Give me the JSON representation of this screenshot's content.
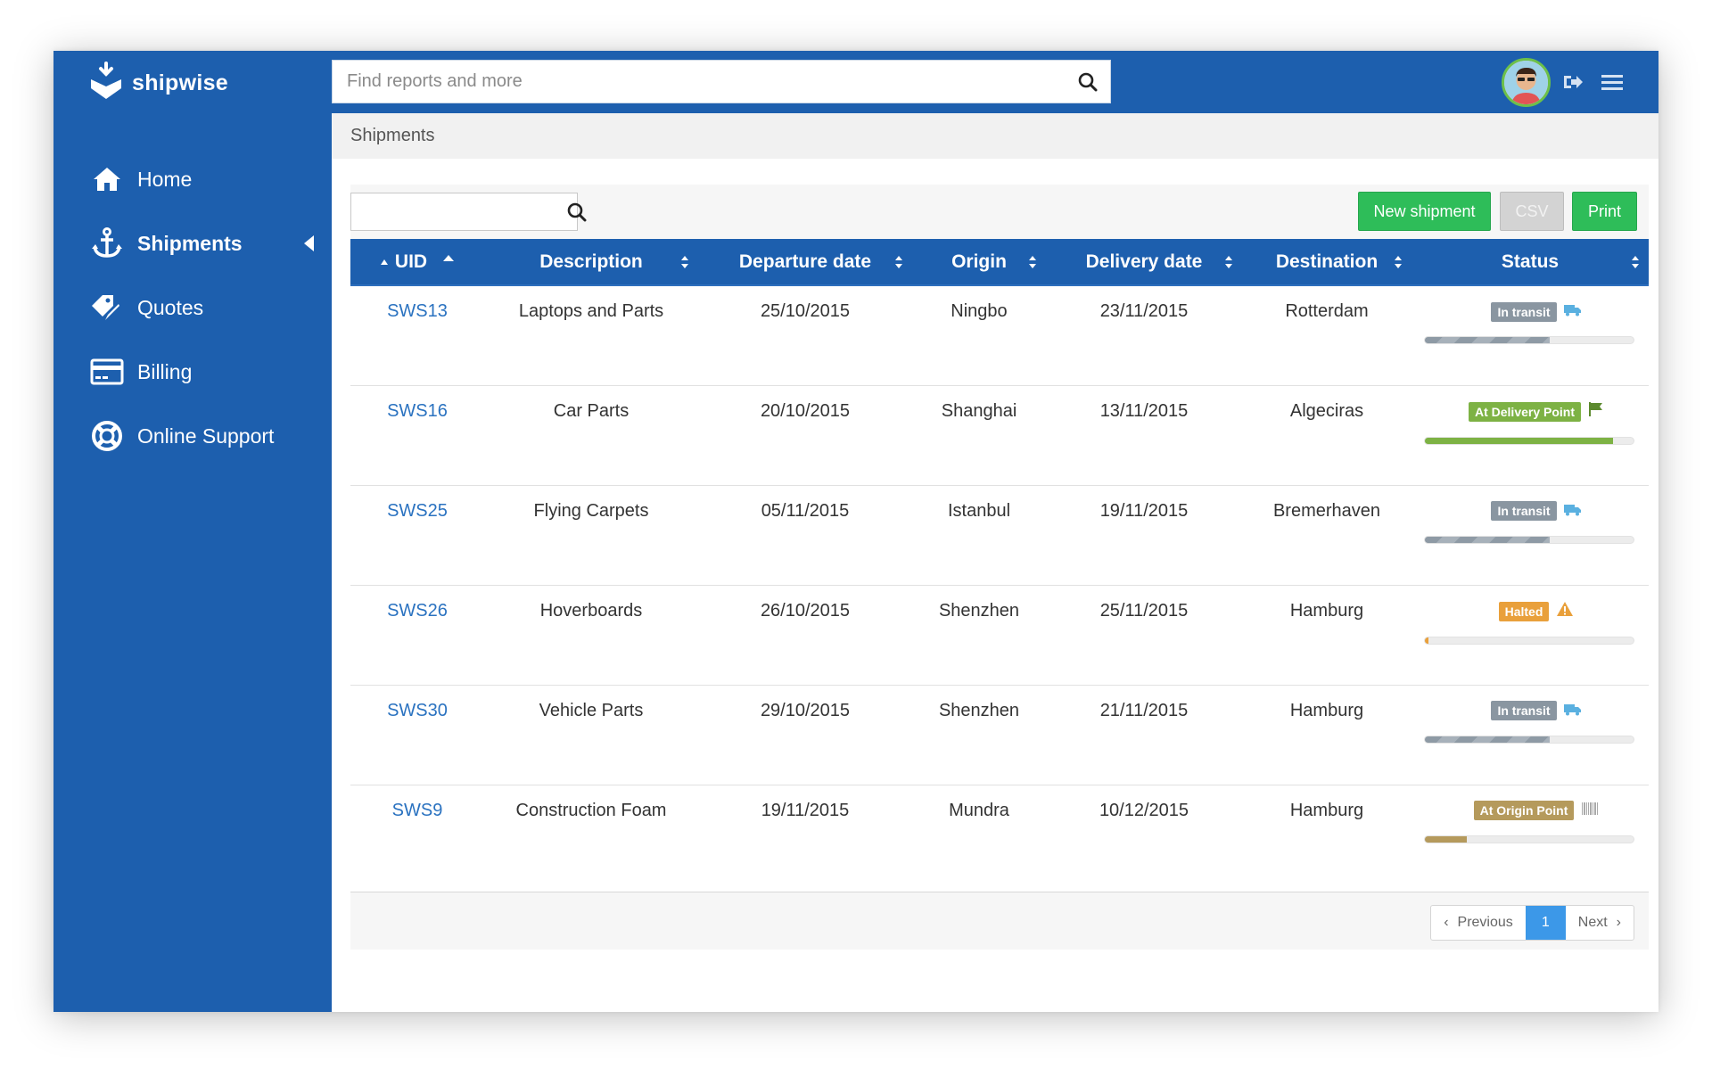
{
  "app": {
    "name": "shipwise"
  },
  "search": {
    "placeholder": "Find reports and more"
  },
  "sidebar": {
    "items": [
      {
        "label": "Home",
        "icon": "home-icon",
        "active": false
      },
      {
        "label": "Shipments",
        "icon": "anchor-icon",
        "active": true
      },
      {
        "label": "Quotes",
        "icon": "tags-icon",
        "active": false
      },
      {
        "label": "Billing",
        "icon": "credit-card-icon",
        "active": false
      },
      {
        "label": "Online Support",
        "icon": "lifebuoy-icon",
        "active": false
      }
    ]
  },
  "breadcrumb": "Shipments",
  "toolbar": {
    "new_label": "New shipment",
    "csv_label": "CSV",
    "print_label": "Print"
  },
  "table": {
    "columns": [
      "UID",
      "Description",
      "Departure date",
      "Origin",
      "Delivery date",
      "Destination",
      "Status"
    ],
    "rows": [
      {
        "uid": "SWS13",
        "description": "Laptops and Parts",
        "departure": "25/10/2015",
        "origin": "Ningbo",
        "delivery": "23/11/2015",
        "destination": "Rotterdam",
        "status": "In transit",
        "status_color": "#8a96a1",
        "icon": "truck-icon",
        "progress": 0.6,
        "bar": "stripe"
      },
      {
        "uid": "SWS16",
        "description": "Car Parts",
        "departure": "20/10/2015",
        "origin": "Shanghai",
        "delivery": "13/11/2015",
        "destination": "Algeciras",
        "status": "At Delivery Point",
        "status_color": "#7db244",
        "icon": "flag-icon",
        "progress": 0.9,
        "bar": "green"
      },
      {
        "uid": "SWS25",
        "description": "Flying Carpets",
        "departure": "05/11/2015",
        "origin": "Istanbul",
        "delivery": "19/11/2015",
        "destination": "Bremerhaven",
        "status": "In transit",
        "status_color": "#8a96a1",
        "icon": "truck-icon",
        "progress": 0.6,
        "bar": "stripe"
      },
      {
        "uid": "SWS26",
        "description": "Hoverboards",
        "departure": "26/10/2015",
        "origin": "Shenzhen",
        "delivery": "25/11/2015",
        "destination": "Hamburg",
        "status": "Halted",
        "status_color": "#e9a03b",
        "icon": "warning-icon",
        "progress": 0.015,
        "bar": "orange"
      },
      {
        "uid": "SWS30",
        "description": "Vehicle Parts",
        "departure": "29/10/2015",
        "origin": "Shenzhen",
        "delivery": "21/11/2015",
        "destination": "Hamburg",
        "status": "In transit",
        "status_color": "#8a96a1",
        "icon": "truck-icon",
        "progress": 0.6,
        "bar": "stripe"
      },
      {
        "uid": "SWS9",
        "description": "Construction Foam",
        "departure": "19/11/2015",
        "origin": "Mundra",
        "delivery": "10/12/2015",
        "destination": "Hamburg",
        "status": "At Origin Point",
        "status_color": "#b59a5c",
        "icon": "barcode-icon",
        "progress": 0.2,
        "bar": "tan"
      }
    ]
  },
  "pagination": {
    "prev": "Previous",
    "current": "1",
    "next": "Next"
  },
  "colors": {
    "brand": "#1d5fae",
    "link": "#2a72c0",
    "green_button": "#2ebd59",
    "page_active": "#3c98e8"
  }
}
